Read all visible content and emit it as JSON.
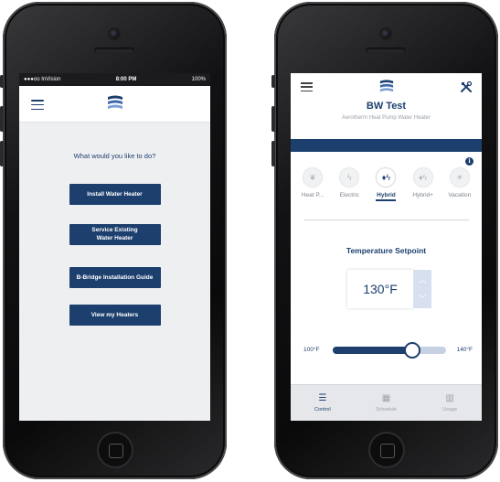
{
  "left_phone": {
    "status": {
      "carrier": "●●●oo InVision",
      "time": "8:00 PM",
      "battery": "100%"
    },
    "question": "What would you like to do?",
    "buttons": {
      "install": "Install Water Heater",
      "service": "Service Existing\nWater Heater",
      "bbridge": "B-Bridge Installation Guide",
      "view": "View my Heaters"
    }
  },
  "right_phone": {
    "title": "BW Test",
    "subtitle": "Aerotherm Heat Pump Water Heater",
    "modes": [
      {
        "label": "Heat P...",
        "icon": "leaf-icon",
        "glyph": "🍃"
      },
      {
        "label": "Electric",
        "icon": "bolt-icon",
        "glyph": "⚡"
      },
      {
        "label": "Hybrid",
        "icon": "flame-bolt-icon",
        "glyph": "🔥"
      },
      {
        "label": "Hybrid+",
        "icon": "flame-bolt-plus-icon",
        "glyph": "🔥"
      },
      {
        "label": "Vacation",
        "icon": "sun-icon",
        "glyph": "☀"
      }
    ],
    "active_mode": "Hybrid",
    "setpoint_title": "Temperature Setpoint",
    "setpoint_value": "130°F",
    "slider": {
      "min_label": "100°F",
      "max_label": "140°F",
      "value_fraction": 0.7
    },
    "tabs": [
      {
        "label": "Control",
        "icon": "sliders-icon"
      },
      {
        "label": "Schedule",
        "icon": "calendar-icon"
      },
      {
        "label": "Usage",
        "icon": "bar-chart-icon"
      }
    ],
    "active_tab": "Control"
  },
  "colors": {
    "brand_navy": "#1d3f6e",
    "light_track": "#c6d2e4"
  }
}
